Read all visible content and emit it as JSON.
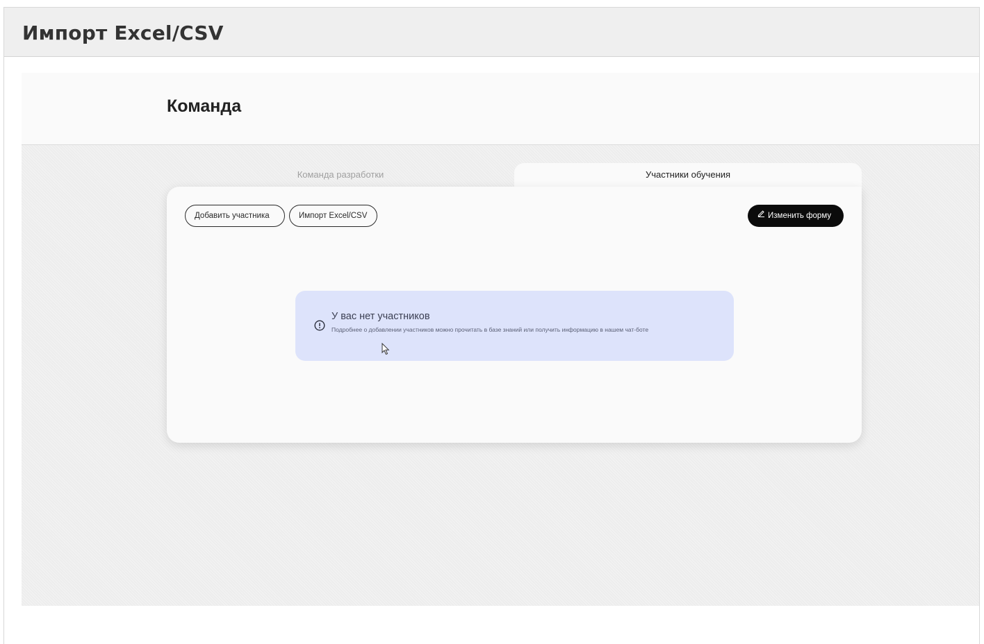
{
  "window": {
    "title": "Импорт Excel/CSV"
  },
  "page": {
    "title": "Команда"
  },
  "tabs": [
    {
      "label": "Команда разработки",
      "active": false
    },
    {
      "label": "Участники обучения",
      "active": true
    }
  ],
  "toolbar": {
    "add_participant_label": "Добавить участника",
    "import_label": "Импорт Excel/CSV",
    "edit_form_label": "Изменить форму"
  },
  "notice": {
    "title": "У вас нет участников",
    "text": "Подробнее о добавлении участников можно прочитать в базе знаний или получить информацию в нашем чат-боте",
    "icon": "info-circle-icon",
    "background_color": "#dde3fb"
  },
  "colors": {
    "primary_button": "#0b0b0b",
    "page_background": "#ededed",
    "card_background": "#fafafa"
  },
  "icons": {
    "edit": "pencil-icon",
    "cursor": "mouse-pointer-icon"
  }
}
